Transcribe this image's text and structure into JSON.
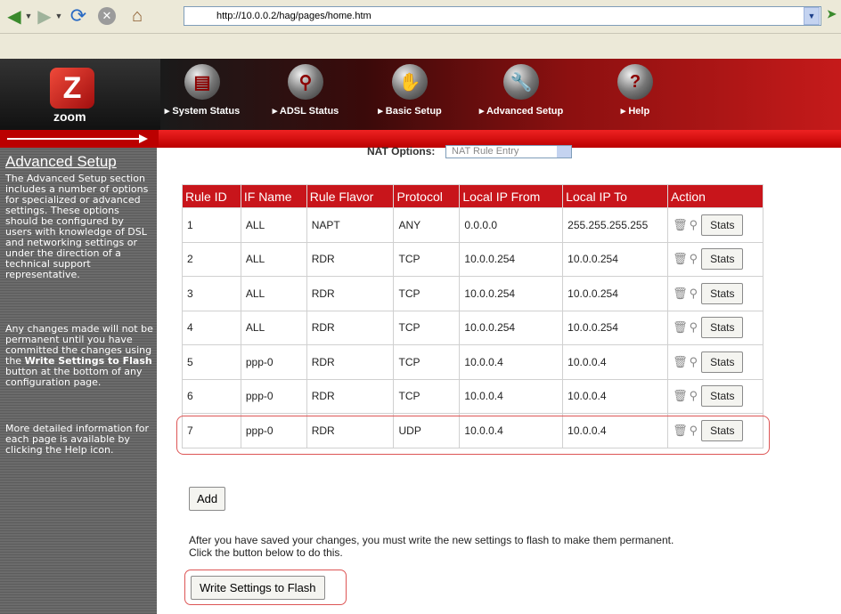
{
  "browser": {
    "url": "http://10.0.0.2/hag/pages/home.htm",
    "icons": [
      "back-arrow-icon",
      "forward-arrow-icon",
      "refresh-icon",
      "stop-icon",
      "home-icon",
      "go-icon"
    ]
  },
  "banner": {
    "logo_text": "zoom",
    "nav": [
      {
        "label": "System Status",
        "icon": "document-icon"
      },
      {
        "label": "ADSL Status",
        "icon": "magnifier-icon"
      },
      {
        "label": "Basic Setup",
        "icon": "hand-icon"
      },
      {
        "label": "Advanced Setup",
        "icon": "wrench-icon"
      },
      {
        "label": "Help",
        "icon": "question-icon"
      }
    ]
  },
  "sidebar": {
    "title": "Advanced Setup",
    "p1": "The Advanced Setup section includes a number of options for specialized or advanced settings. These options should be configured by users with knowledge of DSL and networking settings or under the direction of a technical support representative.",
    "p2_a": "Any changes made will not be permanent until you have committed the changes using the ",
    "p2_bold": "Write Settings to Flash",
    "p2_b": " button at the bottom of any configuration page.",
    "p3": "More detailed information for each page is available by clicking the Help icon."
  },
  "nat": {
    "label": "NAT Options:",
    "selected": "NAT Rule Entry"
  },
  "table": {
    "headers": [
      "Rule ID",
      "IF Name",
      "Rule Flavor",
      "Protocol",
      "Local IP From",
      "Local IP To",
      "Action"
    ],
    "rows": [
      {
        "id": "1",
        "if_name": "ALL",
        "flavor": "NAPT",
        "protocol": "ANY",
        "ip_from": "0.0.0.0",
        "ip_to": "255.255.255.255"
      },
      {
        "id": "2",
        "if_name": "ALL",
        "flavor": "RDR",
        "protocol": "TCP",
        "ip_from": "10.0.0.254",
        "ip_to": "10.0.0.254"
      },
      {
        "id": "3",
        "if_name": "ALL",
        "flavor": "RDR",
        "protocol": "TCP",
        "ip_from": "10.0.0.254",
        "ip_to": "10.0.0.254"
      },
      {
        "id": "4",
        "if_name": "ALL",
        "flavor": "RDR",
        "protocol": "TCP",
        "ip_from": "10.0.0.254",
        "ip_to": "10.0.0.254"
      },
      {
        "id": "5",
        "if_name": "ppp-0",
        "flavor": "RDR",
        "protocol": "TCP",
        "ip_from": "10.0.0.4",
        "ip_to": "10.0.0.4"
      },
      {
        "id": "6",
        "if_name": "ppp-0",
        "flavor": "RDR",
        "protocol": "TCP",
        "ip_from": "10.0.0.4",
        "ip_to": "10.0.0.4"
      },
      {
        "id": "7",
        "if_name": "ppp-0",
        "flavor": "RDR",
        "protocol": "UDP",
        "ip_from": "10.0.0.4",
        "ip_to": "10.0.0.4"
      }
    ],
    "stats_label": "Stats"
  },
  "actions": {
    "add_label": "Add",
    "note_line1": "After you have saved your changes, you must write the new settings to flash to make them permanent.",
    "note_line2": "Click the button below to do this.",
    "write_label": "Write Settings to Flash"
  },
  "colors": {
    "header_red": "#c8151b",
    "highlight": "#d55555"
  }
}
